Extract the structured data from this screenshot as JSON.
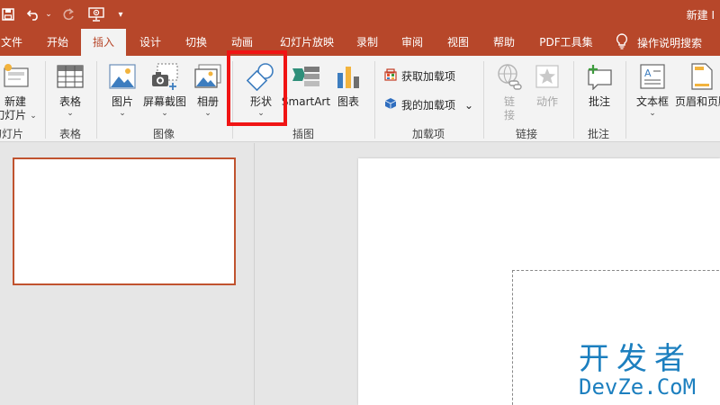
{
  "title_bar": {
    "doc_title": "新建 I",
    "qa_icons": [
      "save-icon",
      "undo-icon",
      "undo-dropdown-icon",
      "redo-icon",
      "start-from-beginning-icon",
      "customize-qat-icon"
    ]
  },
  "tabs": [
    {
      "label": "文件",
      "active": false
    },
    {
      "label": "开始",
      "active": false
    },
    {
      "label": "插入",
      "active": true
    },
    {
      "label": "设计",
      "active": false
    },
    {
      "label": "切换",
      "active": false
    },
    {
      "label": "动画",
      "active": false
    },
    {
      "label": "幻灯片放映",
      "active": false
    },
    {
      "label": "录制",
      "active": false
    },
    {
      "label": "审阅",
      "active": false
    },
    {
      "label": "视图",
      "active": false
    },
    {
      "label": "帮助",
      "active": false
    },
    {
      "label": "PDF工具集",
      "active": false
    }
  ],
  "search": {
    "label": "操作说明搜索",
    "icon": "lightbulb-icon"
  },
  "ribbon": {
    "new_slide": {
      "line1": "新建",
      "line2": "幻灯片",
      "caret": "⌄"
    },
    "table": {
      "label": "表格",
      "caret": "⌄"
    },
    "picture": {
      "label": "图片",
      "caret": "⌄"
    },
    "screenshot": {
      "label": "屏幕截图",
      "caret": "⌄"
    },
    "album": {
      "label": "相册",
      "caret": "⌄"
    },
    "shapes": {
      "label": "形状",
      "caret": "⌄"
    },
    "smartart": {
      "label": "SmartArt"
    },
    "chart": {
      "label": "图表"
    },
    "get_addins": {
      "label": "获取加载项"
    },
    "my_addins": {
      "label": "我的加载项",
      "caret": "⌄"
    },
    "link": {
      "label": "链接"
    },
    "action": {
      "label": "动作"
    },
    "comment": {
      "label": "批注"
    },
    "textbox": {
      "label": "文本框",
      "caret": "⌄"
    },
    "header_footer": {
      "label": "页眉和页脚"
    },
    "groups": {
      "slides": "幻灯片",
      "tables": "表格",
      "images": "图像",
      "illustrations": "插图",
      "addins": "加载项",
      "links": "链接",
      "comments": "批注"
    }
  },
  "colors": {
    "accent": "#b7472a",
    "highlight": "#f01414",
    "watermark": "#1c7fbf"
  },
  "watermark": {
    "line1": "开发者",
    "line2": "DevZe.CoM"
  }
}
